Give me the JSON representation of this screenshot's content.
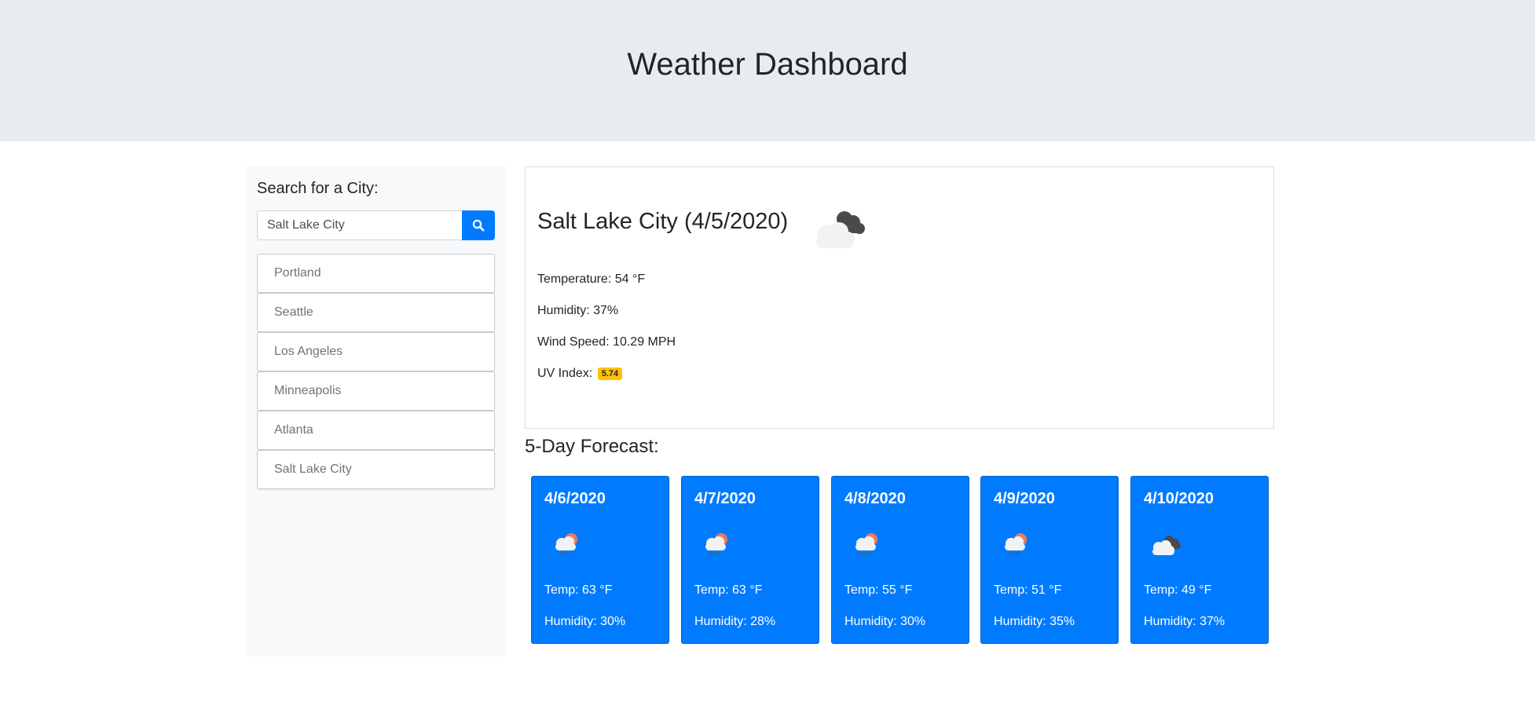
{
  "header": {
    "title": "Weather Dashboard"
  },
  "sidebar": {
    "heading": "Search for a City:",
    "search": {
      "value": "Salt Lake City",
      "icon": "search-icon"
    },
    "cities": [
      "Portland",
      "Seattle",
      "Los Angeles",
      "Minneapolis",
      "Atlanta",
      "Salt Lake City"
    ]
  },
  "current": {
    "title": "Salt Lake City (4/5/2020)",
    "icon": "cloudy-icon",
    "temperature": "Temperature: 54 °F",
    "humidity": "Humidity: 37%",
    "wind": "Wind Speed: 10.29 MPH",
    "uv_label": "UV Index:",
    "uv_value": "5.74",
    "uv_color": "#ffc107"
  },
  "forecast": {
    "title": "5-Day Forecast:",
    "accent": "#007bff",
    "days": [
      {
        "date": "4/6/2020",
        "icon": "rain-sun-icon",
        "temp": "Temp: 63 °F",
        "humidity": "Humidity: 30%"
      },
      {
        "date": "4/7/2020",
        "icon": "rain-sun-icon",
        "temp": "Temp: 63 °F",
        "humidity": "Humidity: 28%"
      },
      {
        "date": "4/8/2020",
        "icon": "rain-sun-icon",
        "temp": "Temp: 55 °F",
        "humidity": "Humidity: 30%"
      },
      {
        "date": "4/9/2020",
        "icon": "rain-sun-icon",
        "temp": "Temp: 51 °F",
        "humidity": "Humidity: 35%"
      },
      {
        "date": "4/10/2020",
        "icon": "cloudy-icon",
        "temp": "Temp: 49 °F",
        "humidity": "Humidity: 37%"
      }
    ]
  }
}
